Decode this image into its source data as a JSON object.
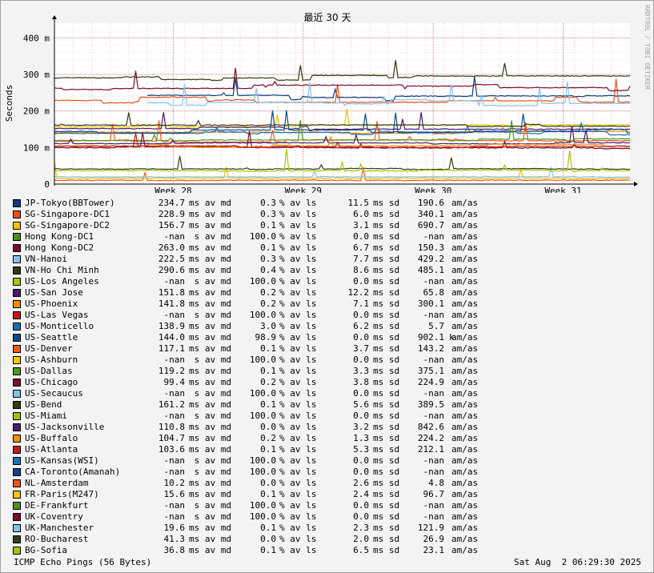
{
  "chart_data": {
    "type": "line",
    "title": "最近 30 天",
    "ylabel": "Seconds",
    "watermark": "RRDTOOL / TOBI OETIKER",
    "y_ticks": [
      {
        "value": 0,
        "label": "0"
      },
      {
        "value": 100,
        "label": "100 m"
      },
      {
        "value": 200,
        "label": "200 m"
      },
      {
        "value": 300,
        "label": "300 m"
      },
      {
        "value": 400,
        "label": "400 m"
      }
    ],
    "ylim_ms": [
      0,
      440
    ],
    "xlim_days": [
      0,
      31
    ],
    "x_ticks": [
      {
        "day": 6.4,
        "label": "Week 28"
      },
      {
        "day": 13.4,
        "label": "Week 29"
      },
      {
        "day": 20.4,
        "label": "Week 30"
      },
      {
        "day": 27.4,
        "label": "Week 31"
      }
    ],
    "grid": true,
    "legend_placement": "bottom",
    "series": [
      {
        "name": "JP-Tokyo(BBTower)",
        "color": "#0a3b7d",
        "avg": "234.7",
        "avg_unit": "ms",
        "loss": "0.3",
        "sd": "11.5",
        "sd_unit": "ms",
        "ratio": "190.6",
        "ratio_k": "",
        "base": 234.7,
        "start": 5
      },
      {
        "name": "SG-Singapore-DC1",
        "color": "#e8501a",
        "avg": "228.9",
        "avg_unit": "ms",
        "loss": "0.3",
        "sd": "6.0",
        "sd_unit": "ms",
        "ratio": "340.1",
        "ratio_k": "",
        "base": 228.9,
        "start": 0
      },
      {
        "name": "SG-Singapore-DC2",
        "color": "#f2c200",
        "avg": "156.7",
        "avg_unit": "ms",
        "loss": "0.1",
        "sd": "3.1",
        "sd_unit": "ms",
        "ratio": "690.7",
        "ratio_k": "",
        "base": 156.7,
        "start": 0
      },
      {
        "name": "Hong Kong-DC1",
        "color": "#4c8c1c",
        "avg": "-nan",
        "avg_unit": " s",
        "loss": "100.0",
        "sd": "0.0",
        "sd_unit": "ms",
        "ratio": "-nan",
        "ratio_k": "",
        "base": null,
        "start": 0
      },
      {
        "name": "Hong Kong-DC2",
        "color": "#7a0a2a",
        "avg": "263.0",
        "avg_unit": "ms",
        "loss": "0.1",
        "sd": "6.7",
        "sd_unit": "ms",
        "ratio": "150.3",
        "ratio_k": "",
        "base": 263.0,
        "start": 0
      },
      {
        "name": "VN-Hanoi",
        "color": "#84c1ef",
        "avg": "222.5",
        "avg_unit": "ms",
        "loss": "0.3",
        "sd": "7.7",
        "sd_unit": "ms",
        "ratio": "429.2",
        "ratio_k": "",
        "base": 222.5,
        "start": 5
      },
      {
        "name": "VN-Ho Chi Minh",
        "color": "#2e3a0e",
        "avg": "290.6",
        "avg_unit": "ms",
        "loss": "0.4",
        "sd": "8.6",
        "sd_unit": "ms",
        "ratio": "485.1",
        "ratio_k": "",
        "base": 290.6,
        "start": 0
      },
      {
        "name": "US-Los Angeles",
        "color": "#a8c410",
        "avg": "-nan",
        "avg_unit": " s",
        "loss": "100.0",
        "sd": "0.0",
        "sd_unit": "ms",
        "ratio": "-nan",
        "ratio_k": "",
        "base": null,
        "start": 0
      },
      {
        "name": "US-San Jose",
        "color": "#4a1a6e",
        "avg": "151.8",
        "avg_unit": "ms",
        "loss": "0.2",
        "sd": "12.2",
        "sd_unit": "ms",
        "ratio": "65.8",
        "ratio_k": "",
        "base": 151.8,
        "start": 0
      },
      {
        "name": "US-Phoenix",
        "color": "#f28c00",
        "avg": "141.8",
        "avg_unit": "ms",
        "loss": "0.2",
        "sd": "7.1",
        "sd_unit": "ms",
        "ratio": "300.1",
        "ratio_k": "",
        "base": 141.8,
        "start": 0
      },
      {
        "name": "US-Las Vegas",
        "color": "#c81414",
        "avg": "-nan",
        "avg_unit": " s",
        "loss": "100.0",
        "sd": "0.0",
        "sd_unit": "ms",
        "ratio": "-nan",
        "ratio_k": "",
        "base": null,
        "start": 0
      },
      {
        "name": "US-Monticello",
        "color": "#1a6eb0",
        "avg": "138.9",
        "avg_unit": "ms",
        "loss": "3.0",
        "sd": "6.2",
        "sd_unit": "ms",
        "ratio": "5.7",
        "ratio_k": "",
        "base": 138.9,
        "start": 0
      },
      {
        "name": "US-Seattle",
        "color": "#0a4a8c",
        "avg": "144.0",
        "avg_unit": "ms",
        "loss": "98.9",
        "sd": "0.0",
        "sd_unit": "ms",
        "ratio": "902.1",
        "ratio_k": "k",
        "base": 144.0,
        "start": 0
      },
      {
        "name": "US-Denver",
        "color": "#f05a1a",
        "avg": "117.1",
        "avg_unit": "ms",
        "loss": "0.1",
        "sd": "3.7",
        "sd_unit": "ms",
        "ratio": "143.2",
        "ratio_k": "",
        "base": 117.1,
        "start": 0
      },
      {
        "name": "US-Ashburn",
        "color": "#f2c800",
        "avg": "-nan",
        "avg_unit": " s",
        "loss": "100.0",
        "sd": "0.0",
        "sd_unit": "ms",
        "ratio": "-nan",
        "ratio_k": "",
        "base": null,
        "start": 0
      },
      {
        "name": "US-Dallas",
        "color": "#4c9a1c",
        "avg": "119.2",
        "avg_unit": "ms",
        "loss": "0.1",
        "sd": "3.3",
        "sd_unit": "ms",
        "ratio": "375.1",
        "ratio_k": "",
        "base": 119.2,
        "start": 0
      },
      {
        "name": "US-Chicago",
        "color": "#7e0a2e",
        "avg": "99.4",
        "avg_unit": "ms",
        "loss": "0.2",
        "sd": "3.8",
        "sd_unit": "ms",
        "ratio": "224.9",
        "ratio_k": "",
        "base": 99.4,
        "start": 0
      },
      {
        "name": "US-Secaucus",
        "color": "#80c0f0",
        "avg": "-nan",
        "avg_unit": " s",
        "loss": "100.0",
        "sd": "0.0",
        "sd_unit": "ms",
        "ratio": "-nan",
        "ratio_k": "",
        "base": null,
        "start": 0
      },
      {
        "name": "US-Bend",
        "color": "#2e3c10",
        "avg": "161.2",
        "avg_unit": "ms",
        "loss": "0.1",
        "sd": "5.6",
        "sd_unit": "ms",
        "ratio": "389.5",
        "ratio_k": "",
        "base": 161.2,
        "start": 0
      },
      {
        "name": "US-Miami",
        "color": "#a0c010",
        "avg": "-nan",
        "avg_unit": " s",
        "loss": "100.0",
        "sd": "0.0",
        "sd_unit": "ms",
        "ratio": "-nan",
        "ratio_k": "",
        "base": null,
        "start": 0
      },
      {
        "name": "US-Jacksonville",
        "color": "#4c1c70",
        "avg": "110.8",
        "avg_unit": "ms",
        "loss": "0.0",
        "sd": "3.2",
        "sd_unit": "ms",
        "ratio": "842.6",
        "ratio_k": "",
        "base": 110.8,
        "start": 0
      },
      {
        "name": "US-Buffalo",
        "color": "#f29000",
        "avg": "104.7",
        "avg_unit": "ms",
        "loss": "0.2",
        "sd": "1.3",
        "sd_unit": "ms",
        "ratio": "224.2",
        "ratio_k": "",
        "base": 104.7,
        "start": 0
      },
      {
        "name": "US-Atlanta",
        "color": "#c41818",
        "avg": "103.6",
        "avg_unit": "ms",
        "loss": "0.1",
        "sd": "5.3",
        "sd_unit": "ms",
        "ratio": "212.1",
        "ratio_k": "",
        "base": 103.6,
        "start": 0
      },
      {
        "name": "US-Kansas(WSI)",
        "color": "#1c72b4",
        "avg": "-nan",
        "avg_unit": " s",
        "loss": "100.0",
        "sd": "0.0",
        "sd_unit": "ms",
        "ratio": "-nan",
        "ratio_k": "",
        "base": null,
        "start": 0
      },
      {
        "name": "CA-Toronto(Amanah)",
        "color": "#0c4488",
        "avg": "-nan",
        "avg_unit": " s",
        "loss": "100.0",
        "sd": "0.0",
        "sd_unit": "ms",
        "ratio": "-nan",
        "ratio_k": "",
        "base": null,
        "start": 0
      },
      {
        "name": "NL-Amsterdam",
        "color": "#ec541c",
        "avg": "10.2",
        "avg_unit": "ms",
        "loss": "0.0",
        "sd": "2.6",
        "sd_unit": "ms",
        "ratio": "4.8",
        "ratio_k": "",
        "base": 10.2,
        "start": 0
      },
      {
        "name": "FR-Paris(M247)",
        "color": "#f4c400",
        "avg": "15.6",
        "avg_unit": "ms",
        "loss": "0.1",
        "sd": "2.4",
        "sd_unit": "ms",
        "ratio": "96.7",
        "ratio_k": "",
        "base": 15.6,
        "start": 0
      },
      {
        "name": "DE-Frankfurt",
        "color": "#4e8e20",
        "avg": "-nan",
        "avg_unit": " s",
        "loss": "100.0",
        "sd": "0.0",
        "sd_unit": "ms",
        "ratio": "-nan",
        "ratio_k": "",
        "base": null,
        "start": 0
      },
      {
        "name": "UK-Coventry",
        "color": "#780c2c",
        "avg": "-nan",
        "avg_unit": " s",
        "loss": "100.0",
        "sd": "0.0",
        "sd_unit": "ms",
        "ratio": "-nan",
        "ratio_k": "",
        "base": null,
        "start": 0
      },
      {
        "name": "UK-Manchester",
        "color": "#86c2ee",
        "avg": "19.6",
        "avg_unit": "ms",
        "loss": "0.1",
        "sd": "2.3",
        "sd_unit": "ms",
        "ratio": "121.9",
        "ratio_k": "",
        "base": 19.6,
        "start": 0
      },
      {
        "name": "RO-Bucharest",
        "color": "#30400c",
        "avg": "41.3",
        "avg_unit": "ms",
        "loss": "0.0",
        "sd": "2.0",
        "sd_unit": "ms",
        "ratio": "26.9",
        "ratio_k": "",
        "base": 41.3,
        "start": 0
      },
      {
        "name": "BG-Sofia",
        "color": "#a4c40e",
        "avg": "36.8",
        "avg_unit": "ms",
        "loss": "0.1",
        "sd": "6.5",
        "sd_unit": "ms",
        "ratio": "23.1",
        "ratio_k": "",
        "base": 36.8,
        "start": 0
      }
    ],
    "labels": {
      "av_md": "av md",
      "av_ls": "% av ls",
      "sd": "sd",
      "am_as": "am/as"
    }
  },
  "footer": {
    "left": "ICMP Echo Pings (56 Bytes)",
    "right": "Sat Aug  2 06:29:30 2025"
  }
}
